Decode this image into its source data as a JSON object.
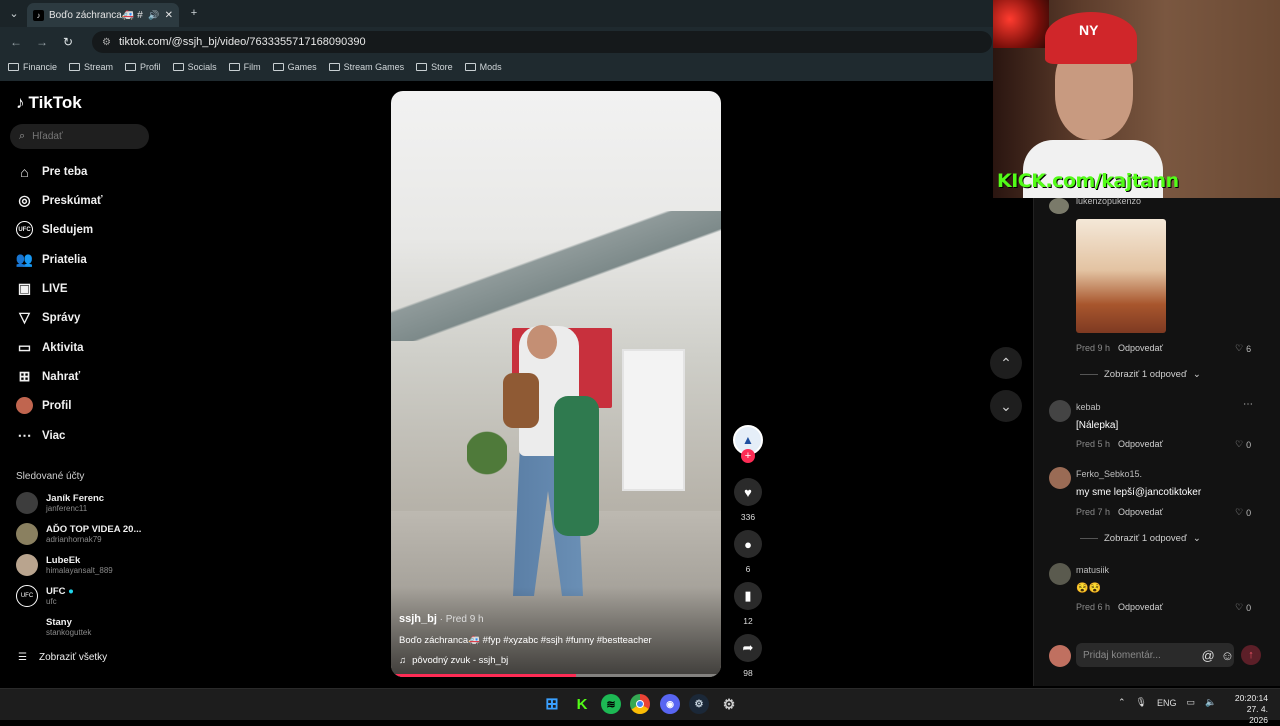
{
  "browser": {
    "tab_title": "Boďo záchranca🚑 #fyp #",
    "url": "tiktok.com/@ssjh_bj/video/7633355717168090390",
    "bookmarks": [
      "Financie",
      "Stream",
      "Profil",
      "Socials",
      "Film",
      "Games",
      "Stream Games",
      "Store",
      "Mods"
    ]
  },
  "sidebar": {
    "logo": "TikTok",
    "search_placeholder": "Hľadať",
    "nav": [
      {
        "label": "Pre teba",
        "icon": "home-icon"
      },
      {
        "label": "Preskúmať",
        "icon": "compass-icon"
      },
      {
        "label": "Sledujem",
        "icon": "following-icon"
      },
      {
        "label": "Priatelia",
        "icon": "friends-icon"
      },
      {
        "label": "LIVE",
        "icon": "live-icon"
      },
      {
        "label": "Správy",
        "icon": "messages-icon"
      },
      {
        "label": "Aktivita",
        "icon": "activity-icon"
      },
      {
        "label": "Nahrať",
        "icon": "upload-icon"
      },
      {
        "label": "Profil",
        "icon": "profile-avatar"
      },
      {
        "label": "Viac",
        "icon": "more-icon"
      }
    ],
    "followed_title": "Sledované účty",
    "followed": [
      {
        "name": "Janík Ferenc",
        "handle": "janferenc11"
      },
      {
        "name": "AĎO TOP VIDEA 20...",
        "handle": "adrianhornak79"
      },
      {
        "name": "LubeEk",
        "handle": "himalayansalt_889"
      },
      {
        "name": "UFC",
        "handle": "ufc"
      },
      {
        "name": "Stany",
        "handle": "stankoguttek"
      }
    ],
    "show_all": "Zobraziť všetky"
  },
  "video": {
    "author": "ssjh_bj",
    "ago": " · Pred 9 h",
    "caption": "Boďo záchranca🚑 #fyp #xyzabc #ssjh #funny #bestteacher",
    "sound": "pôvodný zvuk - ssjh_bj",
    "progress": 0.56
  },
  "actions": {
    "likes": "336",
    "comments": "6",
    "saves": "12",
    "shares": "98"
  },
  "webcam": {
    "kick": "KICK.com/kajtann"
  },
  "comments": {
    "items": [
      {
        "name": "lukenzopukenzo",
        "text": "",
        "time": "Pred 9 h",
        "reply": "Odpovedať",
        "likes": "6"
      },
      {
        "name": "kebab",
        "text": "[Nálepka]",
        "time": "Pred 5 h",
        "reply": "Odpovedať",
        "likes": "0"
      },
      {
        "name": "Ferko_Sebko15.",
        "text": "my sme lepší@jancotiktoker",
        "time": "Pred 7 h",
        "reply": "Odpovedať",
        "likes": "0"
      },
      {
        "name": "matusiik",
        "text": "😵😵",
        "time": "Pred 6 h",
        "reply": "Odpovedať",
        "likes": "0"
      }
    ],
    "more_replies": "Zobraziť 1 odpoveď",
    "input_placeholder": "Pridaj komentár..."
  },
  "taskbar": {
    "lang": "ENG",
    "time": "20:20:14",
    "date": "27. 4. 2026"
  }
}
